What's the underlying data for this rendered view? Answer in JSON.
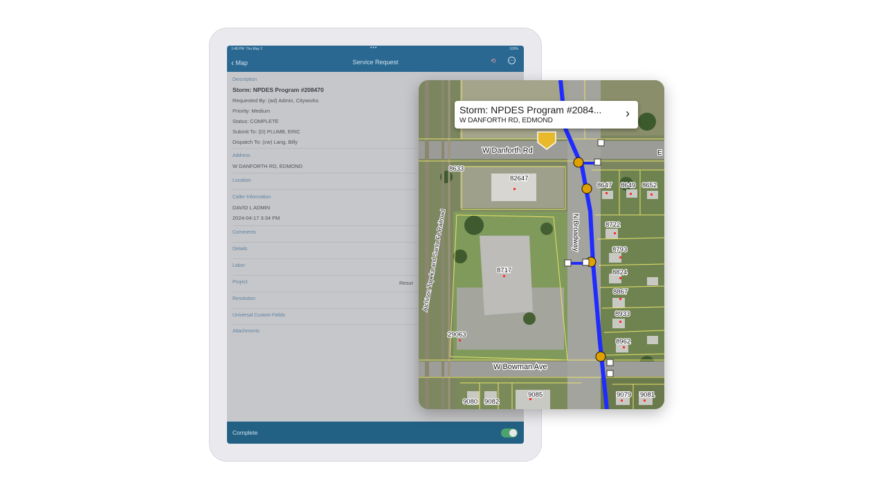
{
  "statusbar": {
    "time": "1:48 PM",
    "date": "Thu May 2",
    "battery": "100%"
  },
  "navbar": {
    "back_label": "Map",
    "title": "Service Request"
  },
  "description": {
    "label": "Description",
    "title": "Storm: NPDES Program #208470",
    "requested_by": "Requested By: (ad) Admin, Cityworks",
    "priority": "Priority: Medium",
    "status": "Status: COMPLETE",
    "submit_to": "Submit To: (D) PLUMB, ERIC",
    "dispatch_to": "Dispatch To: (cw) Lang, Billy"
  },
  "address": {
    "label": "Address",
    "value": "W DANFORTH RD, EDMOND"
  },
  "location": {
    "label": "Location"
  },
  "caller": {
    "label": "Caller Information",
    "name": "DAVID L ADMIN",
    "datetime": "2024-04-17 3:34 PM"
  },
  "rows": {
    "comments": "Comments",
    "details": "Details",
    "labor": "Labor",
    "project": "Project",
    "project_value": "Resur",
    "resolution": "Resolution",
    "universal": "Universal Custom Fields",
    "attachments": "Attachments"
  },
  "bottom": {
    "label": "Complete",
    "toggle_on": true
  },
  "map": {
    "callout_title": "Storm: NPDES Program #2084...",
    "callout_subtitle": "W DANFORTH RD, EDMOND",
    "roads": {
      "danforth": "W Danforth Rd",
      "bowman": "W Bowman Ave",
      "broadway": "N Broadway",
      "railroad": "Atchison Topeka and Santa Fe Railroad",
      "east_edge": "E"
    },
    "parcels": [
      "8633",
      "82647",
      "8647",
      "8649",
      "8652",
      "8722",
      "8793",
      "8717",
      "8824",
      "8867",
      "8933",
      "8962",
      "29063",
      "9080",
      "9082",
      "9085",
      "9079",
      "9081"
    ],
    "colors": {
      "pipe": "#1f2bff",
      "parcel_line": "#e8e36a",
      "callout_marker": "#e8b92a",
      "node": "#e0a000"
    }
  }
}
